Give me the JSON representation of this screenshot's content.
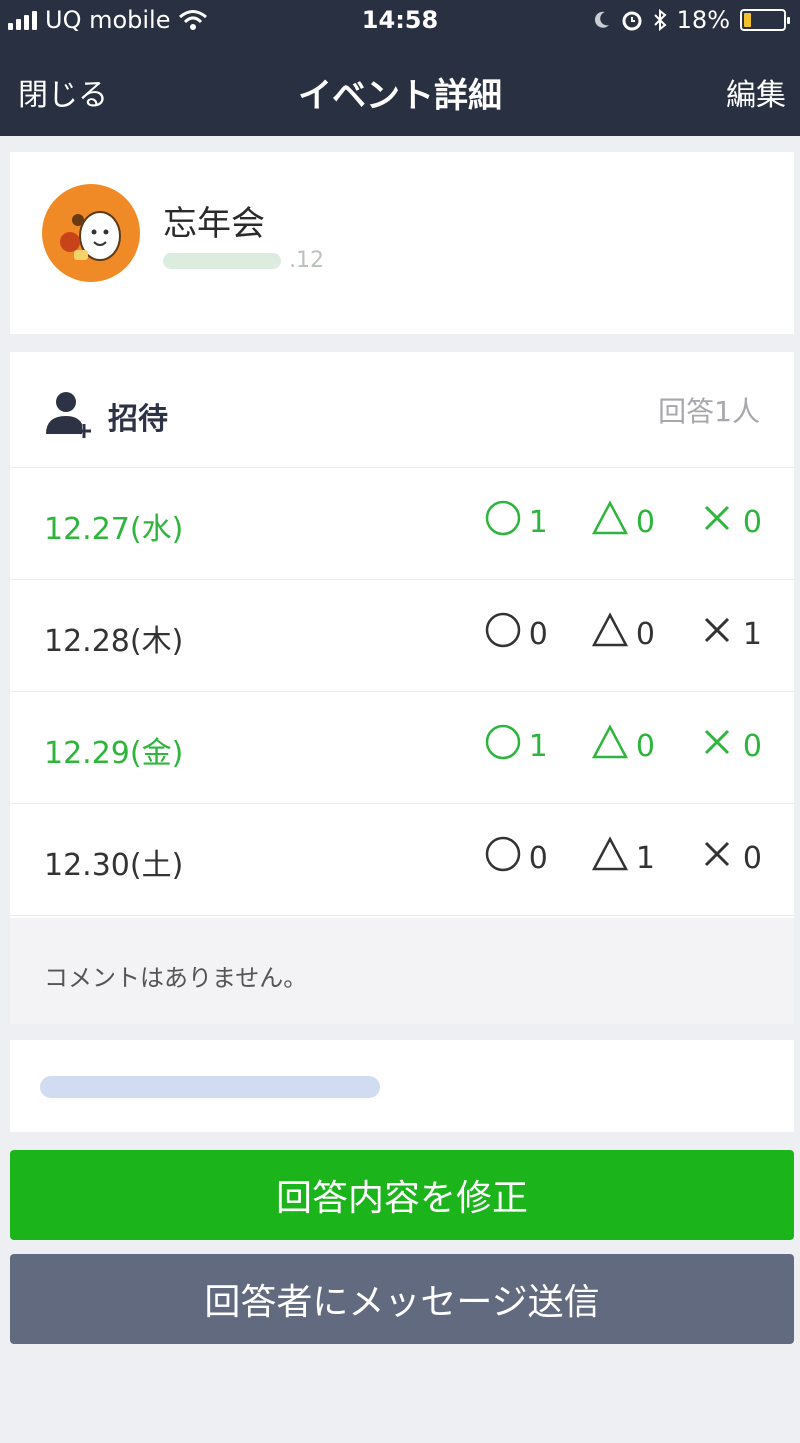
{
  "status_bar": {
    "carrier": "UQ mobile",
    "time": "14:58",
    "battery": "18%",
    "battery_level": 0.18
  },
  "nav": {
    "close": "閉じる",
    "title": "イベント詳細",
    "edit": "編集"
  },
  "event": {
    "title": "忘年会",
    "date_suffix": ".12"
  },
  "invite": {
    "label": "招待",
    "answer_count": "回答1人"
  },
  "dates": [
    {
      "date": "12.27(水)",
      "ok": "1",
      "maybe": "0",
      "no": "0",
      "highlight": true
    },
    {
      "date": "12.28(木)",
      "ok": "0",
      "maybe": "0",
      "no": "1",
      "highlight": false
    },
    {
      "date": "12.29(金)",
      "ok": "1",
      "maybe": "0",
      "no": "0",
      "highlight": true
    },
    {
      "date": "12.30(土)",
      "ok": "0",
      "maybe": "1",
      "no": "0",
      "highlight": false
    }
  ],
  "comment": "コメントはありません。",
  "buttons": {
    "fix": "回答内容を修正",
    "message": "回答者にメッセージ送信"
  },
  "colors": {
    "nav_bg": "#283042",
    "accent_green": "#2db53c",
    "button_green": "#1bb41b",
    "button_gray": "#626a80"
  }
}
